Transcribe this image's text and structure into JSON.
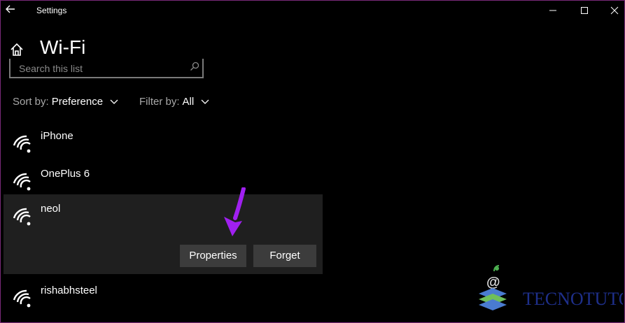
{
  "window": {
    "app_title": "Settings"
  },
  "page": {
    "title": "Wi-Fi"
  },
  "search": {
    "placeholder": "Search this list"
  },
  "sort": {
    "label": "Sort by:",
    "value": "Preference"
  },
  "filter": {
    "label": "Filter by:",
    "value": "All"
  },
  "networks": [
    {
      "name": "iPhone"
    },
    {
      "name": "OnePlus 6"
    },
    {
      "name": "neol",
      "buttons": {
        "properties": "Properties",
        "forget": "Forget"
      }
    },
    {
      "name": "rishabhsteel"
    }
  ],
  "watermark": {
    "text": "TECNOTUTO",
    "color": "#1e2f8a"
  },
  "colors": {
    "background": "#000000",
    "selected_row": "#1f1f1f",
    "button": "#3c3c3c",
    "annotation_arrow": "#a020f0",
    "window_border": "#7a2a7a"
  },
  "icons": {
    "back": "back-arrow-icon",
    "home": "home-icon",
    "search": "search-icon",
    "network": "wifi-signal-icon",
    "minimize": "minimize-icon",
    "maximize": "maximize-icon",
    "close": "close-icon"
  }
}
